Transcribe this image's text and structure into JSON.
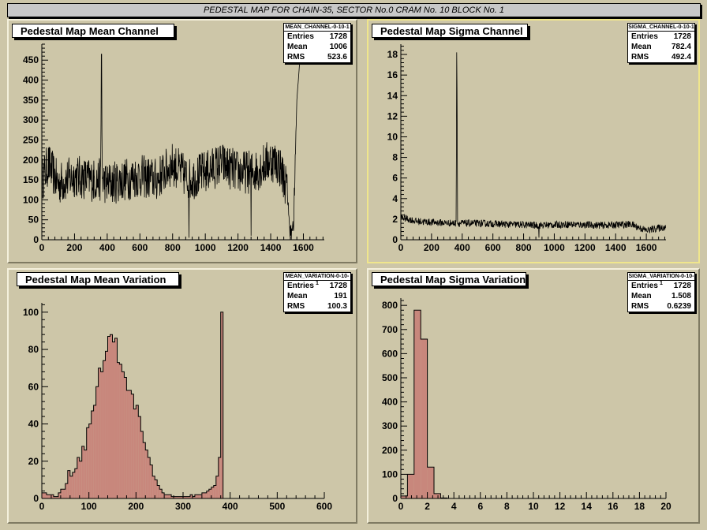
{
  "window_title": "PEDESTAL MAP FOR CHAIN-35, SECTOR No.0 CRAM No. 10 BLOCK No. 1",
  "colors": {
    "background": "#cdc6a8",
    "fill": "#c8877c",
    "line": "#000000"
  },
  "chart_data": [
    {
      "id": "mean_channel",
      "type": "line",
      "title": "Pedestal Map Mean Channel",
      "stats": {
        "name": "MEAN_CHANNEL-0-10-1",
        "entries": "1728",
        "mean": "1006",
        "rms": "523.6",
        "labels": {
          "entries": "Entries",
          "mean": "Mean",
          "rms": "RMS"
        }
      },
      "xlim": [
        0,
        1728
      ],
      "ylim": [
        0,
        490
      ],
      "xticks": [
        0,
        200,
        400,
        600,
        800,
        1000,
        1200,
        1400,
        1600
      ],
      "yticks": [
        0,
        50,
        100,
        150,
        200,
        250,
        300,
        350,
        400,
        450
      ],
      "series_profile": {
        "description_points": [
          [
            0,
            150
          ],
          [
            40,
            190
          ],
          [
            100,
            140
          ],
          [
            200,
            160
          ],
          [
            300,
            150
          ],
          [
            360,
            150
          ],
          [
            365,
            465
          ],
          [
            370,
            150
          ],
          [
            400,
            140
          ],
          [
            500,
            150
          ],
          [
            600,
            160
          ],
          [
            700,
            150
          ],
          [
            800,
            190
          ],
          [
            900,
            150
          ],
          [
            1000,
            170
          ],
          [
            1100,
            190
          ],
          [
            1200,
            170
          ],
          [
            1300,
            170
          ],
          [
            1400,
            200
          ],
          [
            1450,
            190
          ],
          [
            1500,
            130
          ],
          [
            1520,
            10
          ],
          [
            1540,
            40
          ],
          [
            1560,
            350
          ],
          [
            1580,
            460
          ],
          [
            1600,
            480
          ]
        ]
      }
    },
    {
      "id": "sigma_channel",
      "type": "line",
      "title": "Pedestal Map Sigma Channel",
      "stats": {
        "name": "SIGMA_CHANNEL-0-10-1",
        "entries": "1728",
        "mean": "782.4",
        "rms": "492.4",
        "labels": {
          "entries": "Entries",
          "mean": "Mean",
          "rms": "RMS"
        }
      },
      "xlim": [
        0,
        1728
      ],
      "ylim": [
        0,
        19
      ],
      "xticks": [
        0,
        200,
        400,
        600,
        800,
        1000,
        1200,
        1400,
        1600
      ],
      "yticks": [
        0,
        2,
        4,
        6,
        8,
        10,
        12,
        14,
        16,
        18
      ],
      "series_profile": {
        "description_points": [
          [
            0,
            2.2
          ],
          [
            100,
            1.8
          ],
          [
            200,
            1.7
          ],
          [
            360,
            1.6
          ],
          [
            365,
            18.2
          ],
          [
            370,
            1.6
          ],
          [
            500,
            1.6
          ],
          [
            700,
            1.5
          ],
          [
            900,
            1.4
          ],
          [
            1100,
            1.5
          ],
          [
            1300,
            1.4
          ],
          [
            1500,
            1.5
          ],
          [
            1600,
            0.9
          ],
          [
            1700,
            1.2
          ]
        ]
      }
    },
    {
      "id": "mean_variation",
      "type": "bar",
      "title": "Pedestal Map Mean Variation",
      "stats": {
        "name": "MEAN_VARIATION-0-10-1",
        "entries": "1728",
        "mean": "191",
        "rms": "100.3",
        "labels": {
          "entries": "Entries",
          "mean": "Mean",
          "rms": "RMS"
        }
      },
      "xlim": [
        0,
        600
      ],
      "ylim": [
        0,
        105
      ],
      "xticks": [
        0,
        100,
        200,
        300,
        400,
        500,
        600
      ],
      "yticks": [
        0,
        20,
        40,
        60,
        80,
        100
      ],
      "bin_width": 5,
      "values": [
        3,
        3,
        2,
        2,
        2,
        1,
        1,
        3,
        5,
        5,
        8,
        15,
        12,
        14,
        16,
        22,
        20,
        28,
        26,
        38,
        40,
        47,
        50,
        60,
        70,
        68,
        74,
        79,
        87,
        88,
        84,
        86,
        73,
        72,
        68,
        65,
        58,
        58,
        56,
        48,
        50,
        44,
        36,
        30,
        26,
        22,
        18,
        12,
        10,
        7,
        5,
        3,
        2,
        2,
        2,
        1,
        1,
        1,
        1,
        1,
        1,
        1,
        1,
        2,
        1,
        2,
        2,
        2,
        3,
        3,
        4,
        5,
        6,
        7,
        12,
        22,
        100,
        0,
        0,
        0,
        0,
        0,
        0,
        0,
        0,
        0,
        0,
        0,
        0,
        0,
        0,
        0,
        0,
        0,
        0,
        0,
        0,
        0,
        0,
        0,
        0,
        0,
        0,
        0,
        0,
        0,
        0,
        0,
        0,
        0,
        0,
        0,
        0,
        0,
        0,
        0,
        0,
        0,
        0,
        0
      ]
    },
    {
      "id": "sigma_variation",
      "type": "bar",
      "title": "Pedestal Map Sigma Variation",
      "stats": {
        "name": "SIGMA_VARIATION-0-10-1",
        "entries": "1728",
        "mean": "1.508",
        "rms": "0.6239",
        "labels": {
          "entries": "Entries",
          "mean": "Mean",
          "rms": "RMS"
        }
      },
      "xlim": [
        0,
        20
      ],
      "ylim": [
        0,
        830
      ],
      "xticks": [
        0,
        2,
        4,
        6,
        8,
        10,
        12,
        14,
        16,
        18,
        20
      ],
      "yticks": [
        0,
        100,
        200,
        300,
        400,
        500,
        600,
        700,
        800
      ],
      "bin_width": 0.5,
      "values": [
        10,
        100,
        780,
        660,
        130,
        20,
        2,
        0,
        0,
        0,
        0,
        0,
        0,
        0,
        0,
        0,
        0,
        0,
        0,
        0,
        0,
        0,
        0,
        0,
        0,
        0,
        0,
        0,
        0,
        0,
        0,
        0,
        0,
        0,
        0,
        0,
        0,
        0,
        0,
        0
      ]
    }
  ]
}
